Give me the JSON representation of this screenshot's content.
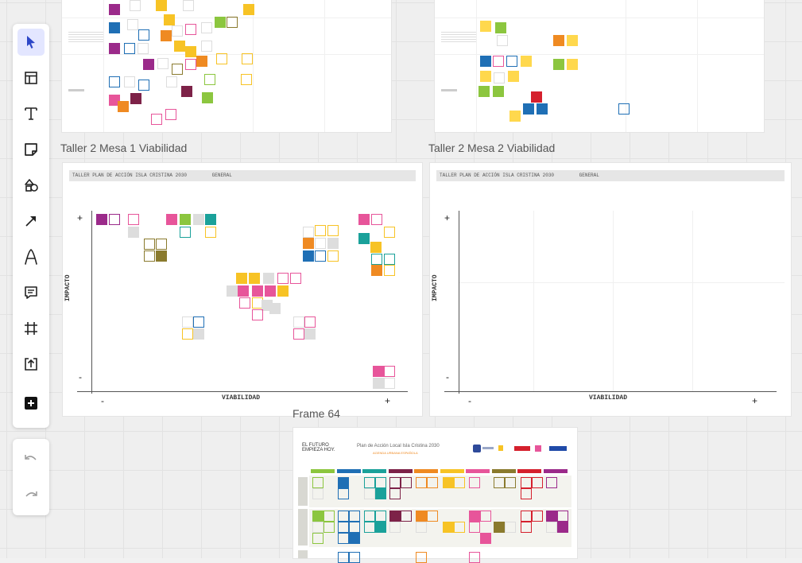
{
  "frames": {
    "top_left": {},
    "top_right": {},
    "mid_left": {
      "label": "Taller 2 Mesa 1 Viabilidad",
      "header_title": "TALLER PLAN DE ACCIÓN ISLA CRISTINA 2030",
      "header_tag": "GENERAL",
      "y_axis": "IMPACTO",
      "x_axis": "VIABILIDAD",
      "plus": "+",
      "minus": "-"
    },
    "mid_right": {
      "label": "Taller 2 Mesa 2 Viabilidad",
      "header_title": "TALLER PLAN DE ACCIÓN ISLA CRISTINA 2030",
      "header_tag": "GENERAL",
      "y_axis": "IMPACTO",
      "x_axis": "VIABILIDAD",
      "plus": "+",
      "minus": "-"
    },
    "bottom": {
      "label": "Frame 64",
      "logo_line1": "EL FUTURO",
      "logo_line2": "EMPIEZA HOY.",
      "title": "Plan de Acción Local Isla Cristina 2030",
      "subtitle": "AGENDA URBANA ESPAÑOLA"
    }
  },
  "toolbar": {
    "tools": [
      {
        "name": "select-tool",
        "icon": "cursor-arrow-icon",
        "active": true
      },
      {
        "name": "templates-tool",
        "icon": "layout-template-icon"
      },
      {
        "name": "text-tool",
        "icon": "text-T-icon"
      },
      {
        "name": "sticky-note-tool",
        "icon": "sticky-note-icon"
      },
      {
        "name": "shapes-tool",
        "icon": "shapes-icon"
      },
      {
        "name": "connector-tool",
        "icon": "arrow-line-icon"
      },
      {
        "name": "pen-tool",
        "icon": "pen-A-icon"
      },
      {
        "name": "comment-tool",
        "icon": "comment-icon"
      },
      {
        "name": "frame-tool",
        "icon": "frame-hash-icon"
      },
      {
        "name": "upload-tool",
        "icon": "upload-icon"
      },
      {
        "name": "more-apps-tool",
        "icon": "plus-icon"
      }
    ],
    "undo": "undo-icon",
    "redo": "redo-icon"
  },
  "colors": {
    "purple": "#9b2a8a",
    "blue": "#1f6fb5",
    "yellow": "#f7c325",
    "orange": "#ef8a22",
    "green": "#8cc63f",
    "teal": "#1aa19a",
    "pink": "#e7559a",
    "maroon": "#7d2248",
    "olive": "#8a7a2d",
    "red": "#d5202d",
    "sticky": "#ffd84d"
  }
}
